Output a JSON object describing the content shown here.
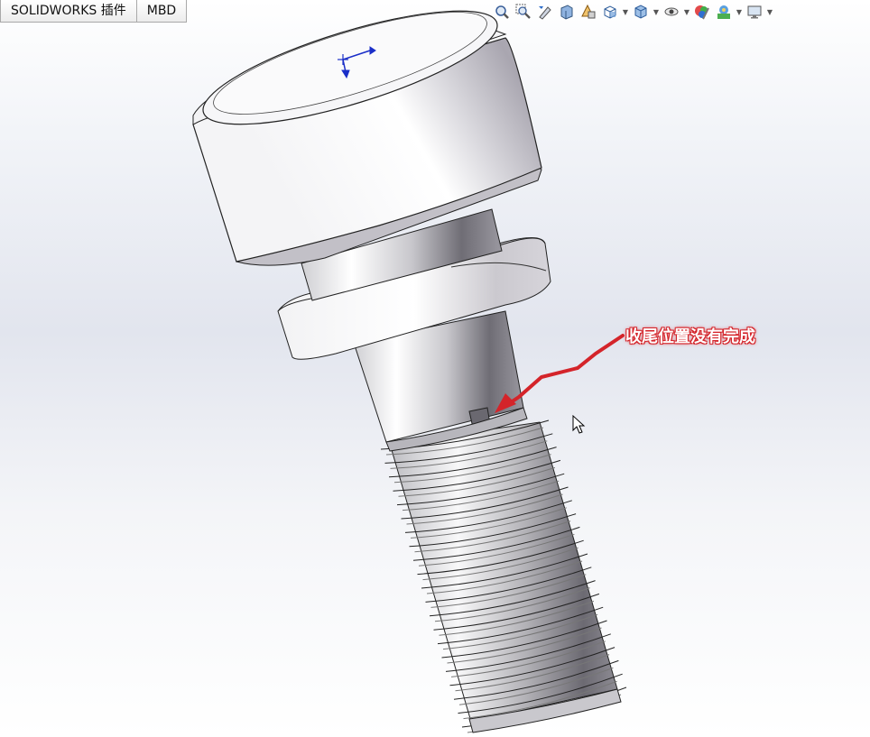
{
  "tabs": [
    {
      "label": "SOLIDWORKS 插件"
    },
    {
      "label": "MBD"
    }
  ],
  "heads_up_toolbar": [
    {
      "icon": "zoom-to-fit-icon"
    },
    {
      "icon": "zoom-to-area-icon"
    },
    {
      "icon": "previous-view-icon"
    },
    {
      "icon": "section-view-icon"
    },
    {
      "icon": "dynamic-annotation-views-icon"
    },
    {
      "icon": "view-orientation-icon",
      "dropdown": true
    },
    {
      "icon": "display-style-icon",
      "dropdown": true
    },
    {
      "icon": "hide-show-items-icon",
      "dropdown": true
    },
    {
      "icon": "edit-appearance-icon"
    },
    {
      "icon": "apply-scene-icon",
      "dropdown": true
    },
    {
      "icon": "view-settings-icon",
      "dropdown": true
    }
  ],
  "annotation": {
    "text": "收尾位置没有完成",
    "color": "#d4242a"
  },
  "model": {
    "part": "screw",
    "colors": {
      "highlight": "#ffffff",
      "body": "#d9d9dd",
      "shadow": "#8d8b94",
      "edge": "#1a1a1a"
    }
  }
}
